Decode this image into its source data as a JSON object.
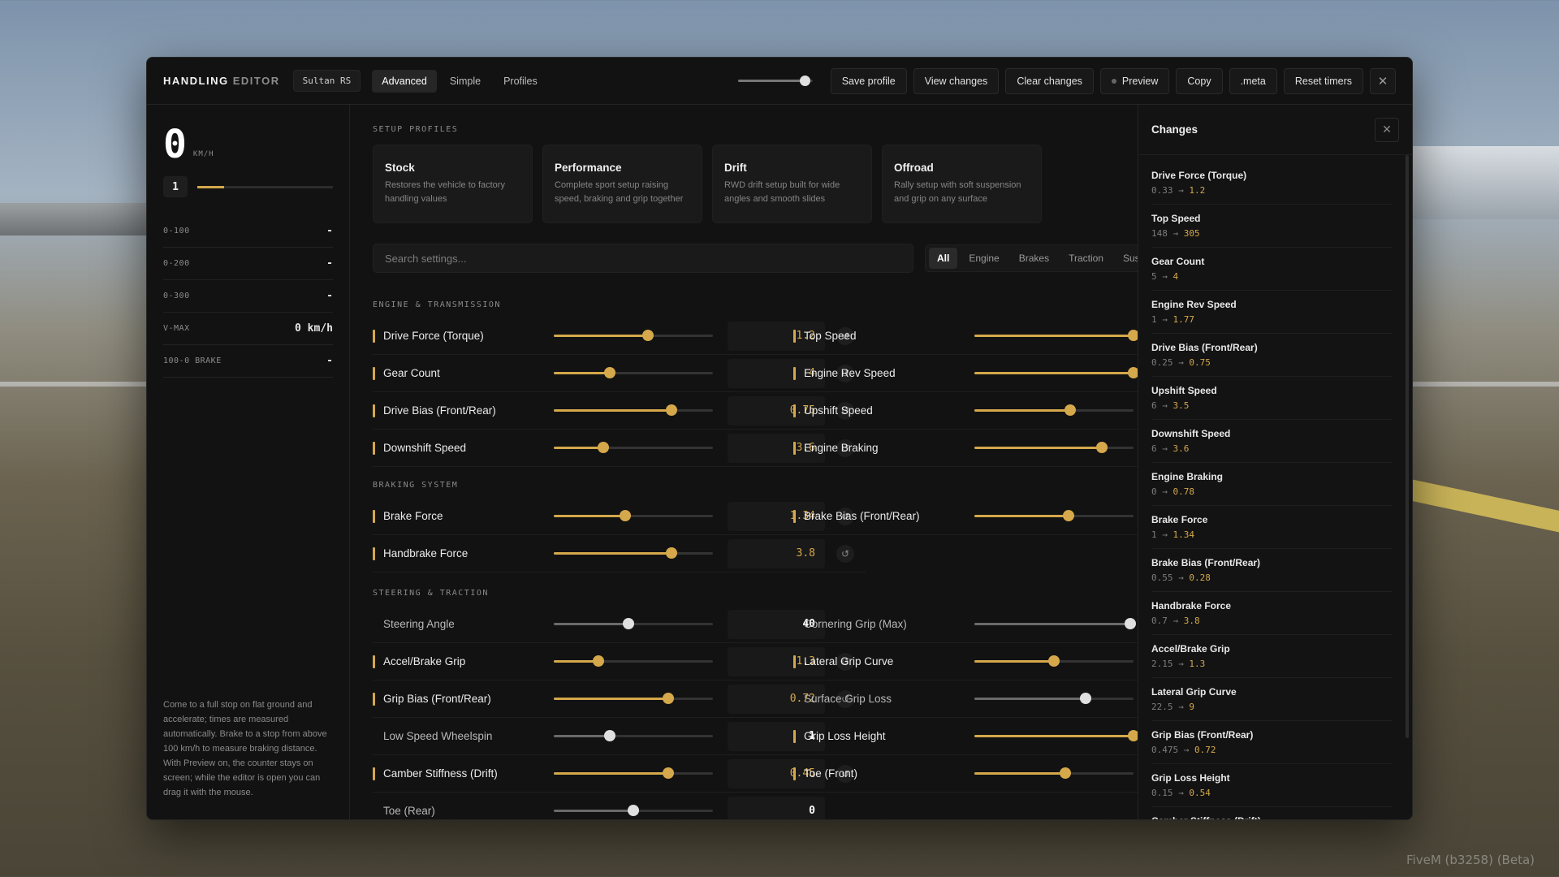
{
  "window": {
    "brand_main": "HANDLING",
    "brand_dim": "EDITOR",
    "vehicle": "Sultan RS",
    "modes": [
      "Advanced",
      "Simple",
      "Profiles"
    ],
    "active_mode": "Advanced",
    "buttons": {
      "save": "Save profile",
      "view": "View changes",
      "clear": "Clear changes",
      "preview": "Preview",
      "copy": "Copy",
      "meta": ".meta",
      "reset_timers": "Reset timers",
      "close": "✕"
    },
    "opacity_level": 0.9
  },
  "left": {
    "speed": "0",
    "speed_unit": "KM/H",
    "gear": "1",
    "rpm_level": 0.2,
    "timers": [
      {
        "label": "0-100",
        "value": "-"
      },
      {
        "label": "0-200",
        "value": "-"
      },
      {
        "label": "0-300",
        "value": "-"
      },
      {
        "label": "V-MAX",
        "value": "0 km/h"
      },
      {
        "label": "100-0 BRAKE",
        "value": "-"
      }
    ],
    "note": "Come to a full stop on flat ground and accelerate; times are measured automatically. Brake to a stop from above 100 km/h to measure braking distance. With Preview on, the counter stays on screen; while the editor is open you can drag it with the mouse."
  },
  "profiles": {
    "title": "SETUP PROFILES",
    "items": [
      {
        "name": "Stock",
        "desc": "Restores the vehicle to factory handling values"
      },
      {
        "name": "Performance",
        "desc": "Complete sport setup raising speed, braking and grip together"
      },
      {
        "name": "Drift",
        "desc": "RWD drift setup built for wide angles and smooth slides"
      },
      {
        "name": "Offroad",
        "desc": "Rally setup with soft suspension and grip on any surface"
      }
    ]
  },
  "search": {
    "placeholder": "Search settings..."
  },
  "filters": [
    "All",
    "Engine",
    "Brakes",
    "Traction",
    "Suspension"
  ],
  "sections": {
    "engine": "ENGINE & TRANSMISSION",
    "braking": "BRAKING SYSTEM",
    "steering": "STEERING & TRACTION"
  },
  "settings": {
    "engine_left": [
      {
        "name": "Drive Force (Torque)",
        "value": "1.2",
        "level": 0.59,
        "changed": true
      },
      {
        "name": "Gear Count",
        "value": "4",
        "level": 0.35,
        "changed": true
      },
      {
        "name": "Drive Bias (Front/Rear)",
        "value": "0.75",
        "level": 0.74,
        "changed": true
      },
      {
        "name": "Downshift Speed",
        "value": "3.6",
        "level": 0.31,
        "changed": true
      }
    ],
    "engine_right": [
      {
        "name": "Top Speed",
        "changed": true,
        "level": 1.0
      },
      {
        "name": "Engine Rev Speed",
        "changed": true,
        "level": 1.0
      },
      {
        "name": "Upshift Speed",
        "changed": true,
        "level": 0.6
      },
      {
        "name": "Engine Braking",
        "changed": true,
        "level": 0.8
      }
    ],
    "braking_left": [
      {
        "name": "Brake Force",
        "value": "1.34",
        "level": 0.45,
        "changed": true
      },
      {
        "name": "Handbrake Force",
        "value": "3.8",
        "level": 0.74,
        "changed": true
      }
    ],
    "braking_right": [
      {
        "name": "Brake Bias (Front/Rear)",
        "changed": true,
        "level": 0.59
      }
    ],
    "steering_left": [
      {
        "name": "Steering Angle",
        "value": "40",
        "level": 0.47,
        "changed": false
      },
      {
        "name": "Accel/Brake Grip",
        "value": "1.3",
        "level": 0.28,
        "changed": true
      },
      {
        "name": "Grip Bias (Front/Rear)",
        "value": "0.72",
        "level": 0.72,
        "changed": true
      },
      {
        "name": "Low Speed Wheelspin",
        "value": "1",
        "level": 0.35,
        "changed": false
      },
      {
        "name": "Camber Stiffness (Drift)",
        "value": "0.45",
        "level": 0.72,
        "changed": true
      },
      {
        "name": "Toe (Rear)",
        "value": "0",
        "level": 0.5,
        "changed": false
      }
    ],
    "steering_right": [
      {
        "name": "Cornering Grip (Max)",
        "changed": false,
        "level": 0.98
      },
      {
        "name": "Lateral Grip Curve",
        "changed": true,
        "level": 0.5
      },
      {
        "name": "Surface Grip Loss",
        "changed": false,
        "level": 0.7
      },
      {
        "name": "Grip Loss Height",
        "changed": true,
        "level": 1.0
      },
      {
        "name": "Toe (Front)",
        "changed": true,
        "level": 0.57
      }
    ]
  },
  "changes": {
    "title": "Changes",
    "items": [
      {
        "name": "Drive Force (Torque)",
        "old": "0.33",
        "new": "1.2"
      },
      {
        "name": "Top Speed",
        "old": "148",
        "new": "305"
      },
      {
        "name": "Gear Count",
        "old": "5",
        "new": "4"
      },
      {
        "name": "Engine Rev Speed",
        "old": "1",
        "new": "1.77"
      },
      {
        "name": "Drive Bias (Front/Rear)",
        "old": "0.25",
        "new": "0.75"
      },
      {
        "name": "Upshift Speed",
        "old": "6",
        "new": "3.5"
      },
      {
        "name": "Downshift Speed",
        "old": "6",
        "new": "3.6"
      },
      {
        "name": "Engine Braking",
        "old": "0",
        "new": "0.78"
      },
      {
        "name": "Brake Force",
        "old": "1",
        "new": "1.34"
      },
      {
        "name": "Brake Bias (Front/Rear)",
        "old": "0.55",
        "new": "0.28"
      },
      {
        "name": "Handbrake Force",
        "old": "0.7",
        "new": "3.8"
      },
      {
        "name": "Accel/Brake Grip",
        "old": "2.15",
        "new": "1.3"
      },
      {
        "name": "Lateral Grip Curve",
        "old": "22.5",
        "new": "9"
      },
      {
        "name": "Grip Bias (Front/Rear)",
        "old": "0.475",
        "new": "0.72"
      },
      {
        "name": "Grip Loss Height",
        "old": "0.15",
        "new": "0.54"
      },
      {
        "name": "Camber Stiffness (Drift)",
        "old": "",
        "new": ""
      }
    ]
  },
  "watermark": "FiveM (b3258) (Beta)",
  "colors": {
    "accent": "#d5a84b",
    "panel": "#121212"
  }
}
